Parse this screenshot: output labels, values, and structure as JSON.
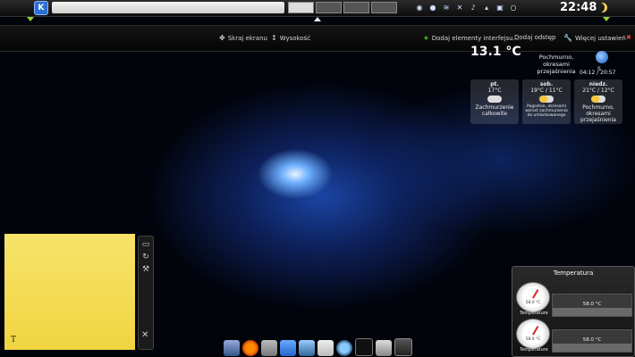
{
  "top_panel": {
    "clock": "22:48"
  },
  "toolbox": {
    "screen_edge": "Skraj ekranu",
    "height": "Wysokość",
    "add_widgets": "Dodaj elementy interfejsu...",
    "add_spacer": "Dodaj odstęp",
    "more_settings": "Więcej ustawień"
  },
  "weather": {
    "current_temp": "13.1 °C",
    "current_condition": "Pochmurno, okresami przejaśnienia",
    "wind": "S",
    "sun_times": "04:12 / 20:57",
    "days": [
      {
        "name": "pt.",
        "temp": "17°C",
        "condition": "Zachmurzenie całkowite"
      },
      {
        "name": "sob.",
        "temp": "19°C / 11°C",
        "condition": "Pogodnie, okresami wzrost zachmurzenia do umiarkowanego"
      },
      {
        "name": "niedz.",
        "temp": "21°C / 12°C",
        "condition": "Pochmurno, okresami przejaśnienia"
      }
    ]
  },
  "note": {
    "marker": "T"
  },
  "temperature_widget": {
    "title": "Temperatura",
    "sensors": [
      {
        "gauge_value": "58.0 °C",
        "label": "Temperature",
        "graph_value": "58.0 °C"
      },
      {
        "gauge_value": "58.0 °C",
        "label": "Temperature",
        "graph_value": "58.0 °C"
      }
    ]
  },
  "colors": {
    "accent_green": "#8fd43a",
    "note_yellow": "#f0d440"
  }
}
